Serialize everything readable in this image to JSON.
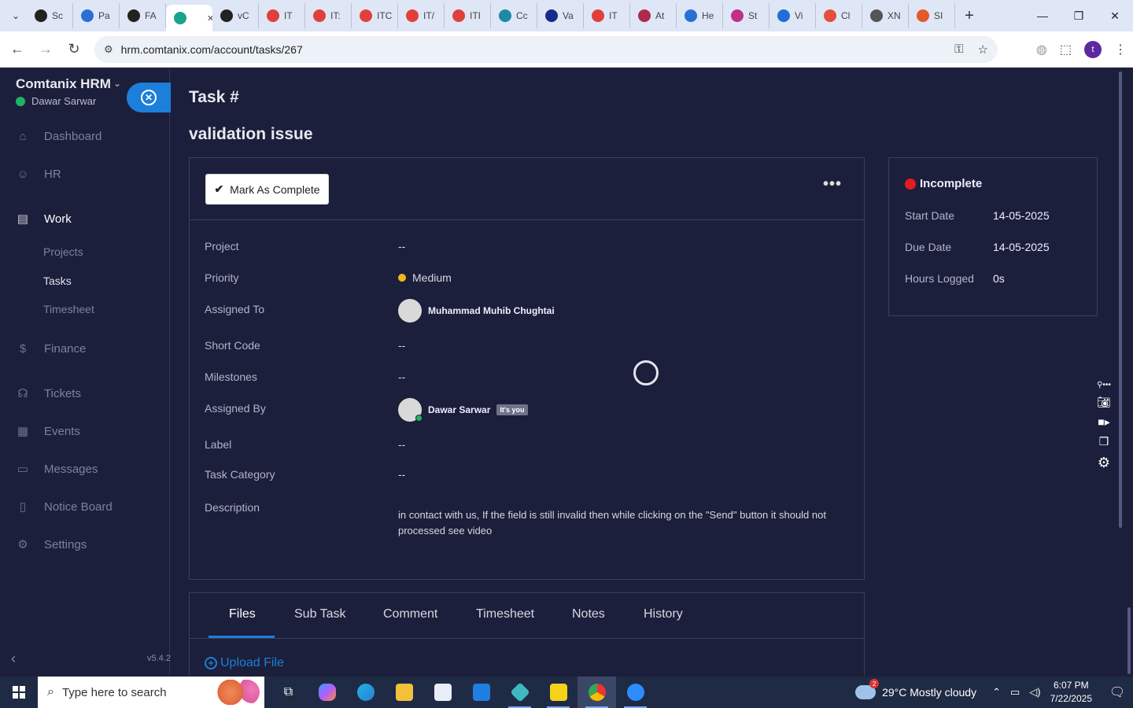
{
  "browser": {
    "tabs": [
      {
        "label": "Sc",
        "color": "#222222"
      },
      {
        "label": "Pa",
        "color": "#2b6fd6"
      },
      {
        "label": "FA",
        "color": "#222222"
      },
      {
        "label": "",
        "color": "#1aa38c",
        "active": true
      },
      {
        "label": "vC",
        "color": "#222222"
      },
      {
        "label": "IT",
        "color": "#e0403b"
      },
      {
        "label": "IT:",
        "color": "#e0403b"
      },
      {
        "label": "ITC",
        "color": "#e0403b"
      },
      {
        "label": "IT/",
        "color": "#e0403b"
      },
      {
        "label": "ITI",
        "color": "#e0403b"
      },
      {
        "label": "Cc",
        "color": "#1c8aa8"
      },
      {
        "label": "Va",
        "color": "#1b2a8a"
      },
      {
        "label": "IT",
        "color": "#e0403b"
      },
      {
        "label": "At",
        "color": "#b02a4a"
      },
      {
        "label": "He",
        "color": "#2b6fd6"
      },
      {
        "label": "St",
        "color": "#c0308a"
      },
      {
        "label": "Vi",
        "color": "#1f6fd6"
      },
      {
        "label": "Cl",
        "color": "#e0503b"
      },
      {
        "label": "XN",
        "color": "#555555"
      },
      {
        "label": "SI",
        "color": "#e05a2a"
      }
    ],
    "url": "hrm.comtanix.com/account/tasks/267",
    "profile_initial": "t"
  },
  "sidebar": {
    "brand": "Comtanix HRM",
    "user": "Dawar Sarwar",
    "menu": [
      {
        "label": "Dashboard",
        "icon": "⌂"
      },
      {
        "label": "HR",
        "icon": "☺"
      },
      {
        "label": "Work",
        "icon": "▤"
      },
      {
        "label": "Finance",
        "icon": "$"
      },
      {
        "label": "Tickets",
        "icon": "☊"
      },
      {
        "label": "Events",
        "icon": "▦"
      },
      {
        "label": "Messages",
        "icon": "▭"
      },
      {
        "label": "Notice Board",
        "icon": "▯"
      },
      {
        "label": "Settings",
        "icon": "⚙"
      }
    ],
    "work_sub": [
      "Projects",
      "Tasks",
      "Timesheet"
    ],
    "version": "v5.4.2"
  },
  "task": {
    "page_title": "Task #",
    "name": "validation issue",
    "mark_complete": "Mark As Complete",
    "more": "•••",
    "fields": {
      "project": {
        "label": "Project",
        "value": "--"
      },
      "priority": {
        "label": "Priority",
        "value": "Medium"
      },
      "assigned_to": {
        "label": "Assigned To",
        "value": "Muhammad Muhib Chughtai"
      },
      "short_code": {
        "label": "Short Code",
        "value": "--"
      },
      "milestones": {
        "label": "Milestones",
        "value": "--"
      },
      "assigned_by": {
        "label": "Assigned By",
        "value": "Dawar Sarwar",
        "badge": "It's you"
      },
      "label": {
        "label": "Label",
        "value": "--"
      },
      "category": {
        "label": "Task Category",
        "value": "--"
      },
      "description": {
        "label": "Description",
        "value": "in contact with us, If the field is still invalid then while clicking on the \"Send\" button it should not processed see video"
      }
    },
    "status": {
      "state": "Incomplete",
      "start_label": "Start Date",
      "start_value": "14-05-2025",
      "due_label": "Due Date",
      "due_value": "14-05-2025",
      "hours_label": "Hours Logged",
      "hours_value": "0s"
    },
    "tabs": [
      "Files",
      "Sub Task",
      "Comment",
      "Timesheet",
      "Notes",
      "History"
    ],
    "upload": "Upload File"
  },
  "taskbar": {
    "search_placeholder": "Type here to search",
    "weather": "29°C  Mostly cloudy",
    "weather_badge": "2",
    "time": "6:07 PM",
    "date": "7/22/2025"
  }
}
